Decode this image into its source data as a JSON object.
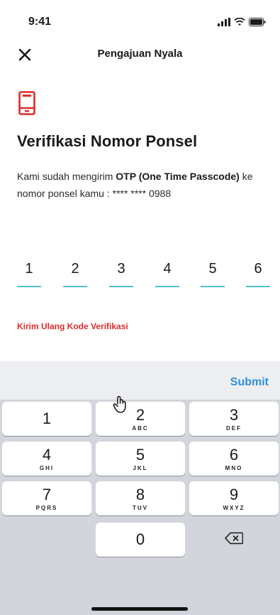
{
  "status_bar": {
    "time": "9:41",
    "icons": [
      "signal-icon",
      "wifi-icon",
      "battery-icon"
    ]
  },
  "header": {
    "title": "Pengajuan Nyala",
    "close_icon": "close-icon"
  },
  "content": {
    "icon": "phone-icon",
    "title": "Verifikasi Nomor Ponsel",
    "desc_part1": "Kami sudah mengirim ",
    "desc_bold1": "OTP (One Time Passcode)",
    "desc_part2": " ke nomor ponsel kamu : **** **** 0988"
  },
  "otp": {
    "digits": [
      "1",
      "2",
      "3",
      "4",
      "5",
      "6"
    ]
  },
  "resend_label": "Kirim Ulang Kode Verifikasi",
  "keyboard": {
    "submit_label": "Submit",
    "keys": [
      {
        "num": "1",
        "letters": ""
      },
      {
        "num": "2",
        "letters": "ABC"
      },
      {
        "num": "3",
        "letters": "DEF"
      },
      {
        "num": "4",
        "letters": "GHI"
      },
      {
        "num": "5",
        "letters": "JKL"
      },
      {
        "num": "6",
        "letters": "MNO"
      },
      {
        "num": "7",
        "letters": "PQRS"
      },
      {
        "num": "8",
        "letters": "TUV"
      },
      {
        "num": "9",
        "letters": "WXYZ"
      },
      {
        "num": "0",
        "letters": ""
      }
    ]
  },
  "colors": {
    "accent": "#e02b2b",
    "underline": "#4fc3c3",
    "submit": "#2f8fd8",
    "keyboard_bg": "#d2d5db"
  }
}
